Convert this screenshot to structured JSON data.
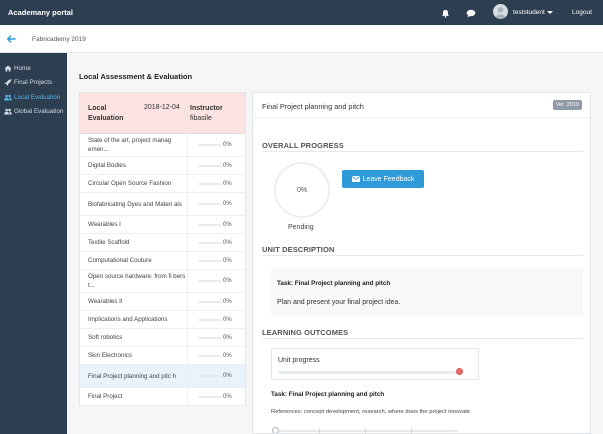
{
  "topbar": {
    "brand": "Academany portal",
    "user_name": "teststudent",
    "logout_label": "Logout",
    "icons": [
      "bell-icon",
      "chat-icon",
      "avatar",
      "chevron-down-icon"
    ]
  },
  "subbar": {
    "breadcrumb": "Fabricademy 2019",
    "back_icon": "arrow-left-icon"
  },
  "sidebar": {
    "items": [
      {
        "label": "Home",
        "icon": "home-icon",
        "active": false
      },
      {
        "label": "Final Projects",
        "icon": "rocket-icon",
        "active": false
      },
      {
        "label": "Local Evaluation",
        "icon": "users-icon",
        "active": true
      },
      {
        "label": "Global Evaluation",
        "icon": "globe-users-icon",
        "active": false
      }
    ]
  },
  "page_title": "Local Assessment & Evaluation",
  "left_panel": {
    "header": {
      "title": "Local Evaluation",
      "date": "2018-12-04",
      "instructor_label": "Instructor",
      "instructor_name": "fibasile"
    },
    "units": [
      {
        "name": "State of the art, project manag emen...",
        "percent": "0%",
        "progress": 0,
        "selected": false
      },
      {
        "name": "Digital Bodies",
        "percent": "0%",
        "progress": 0,
        "selected": false
      },
      {
        "name": "Circular Open Source Fashion",
        "percent": "0%",
        "progress": 0,
        "selected": false
      },
      {
        "name": "Biofabricating Dyes and Materi als",
        "percent": "0%",
        "progress": 0,
        "selected": false
      },
      {
        "name": "Wearables I",
        "percent": "0%",
        "progress": 0,
        "selected": false
      },
      {
        "name": "Textile Scaffold",
        "percent": "0%",
        "progress": 0,
        "selected": false
      },
      {
        "name": "Computational Couture",
        "percent": "0%",
        "progress": 0,
        "selected": false
      },
      {
        "name": "Open source hardware: from fi bers t...",
        "percent": "0%",
        "progress": 0,
        "selected": false
      },
      {
        "name": "Wearables II",
        "percent": "0%",
        "progress": 0,
        "selected": false
      },
      {
        "name": "Implications and Applications",
        "percent": "0%",
        "progress": 0,
        "selected": false
      },
      {
        "name": "Soft robotics",
        "percent": "0%",
        "progress": 0,
        "selected": false
      },
      {
        "name": "Skin Electronics",
        "percent": "0%",
        "progress": 0,
        "selected": false
      },
      {
        "name": "Final Project planning and pitc h",
        "percent": "0%",
        "progress": 0,
        "selected": true
      },
      {
        "name": "Final Project",
        "percent": "0%",
        "progress": 0,
        "selected": false
      }
    ]
  },
  "right_panel": {
    "title": "Final Project planning and pitch",
    "version": "Ver. 2019",
    "overall_progress": {
      "heading": "OVERALL PROGRESS",
      "value": "0%",
      "status": "Pending",
      "feedback_button": "Leave Feedback"
    },
    "unit_description": {
      "heading": "UNIT DESCRIPTION",
      "task": "Task: Final Project planning and pitch",
      "text": "Plan and present your final project idea."
    },
    "learning_outcomes": {
      "heading": "LEARNING OUTCOMES",
      "unit_progress_label": "Unit progress",
      "unit_progress_value": 1.0,
      "task": "Task: Final Project planning and pitch",
      "references": "References: concept development, research, where does the project innovate",
      "slider_value": 0
    }
  },
  "colors": {
    "topbar_bg": "#2d3e50",
    "accent": "#2e9ad8",
    "active_sidebar": "#5ab6e8",
    "header_pink": "#fbe3e2",
    "knob_red": "#e96b64"
  }
}
